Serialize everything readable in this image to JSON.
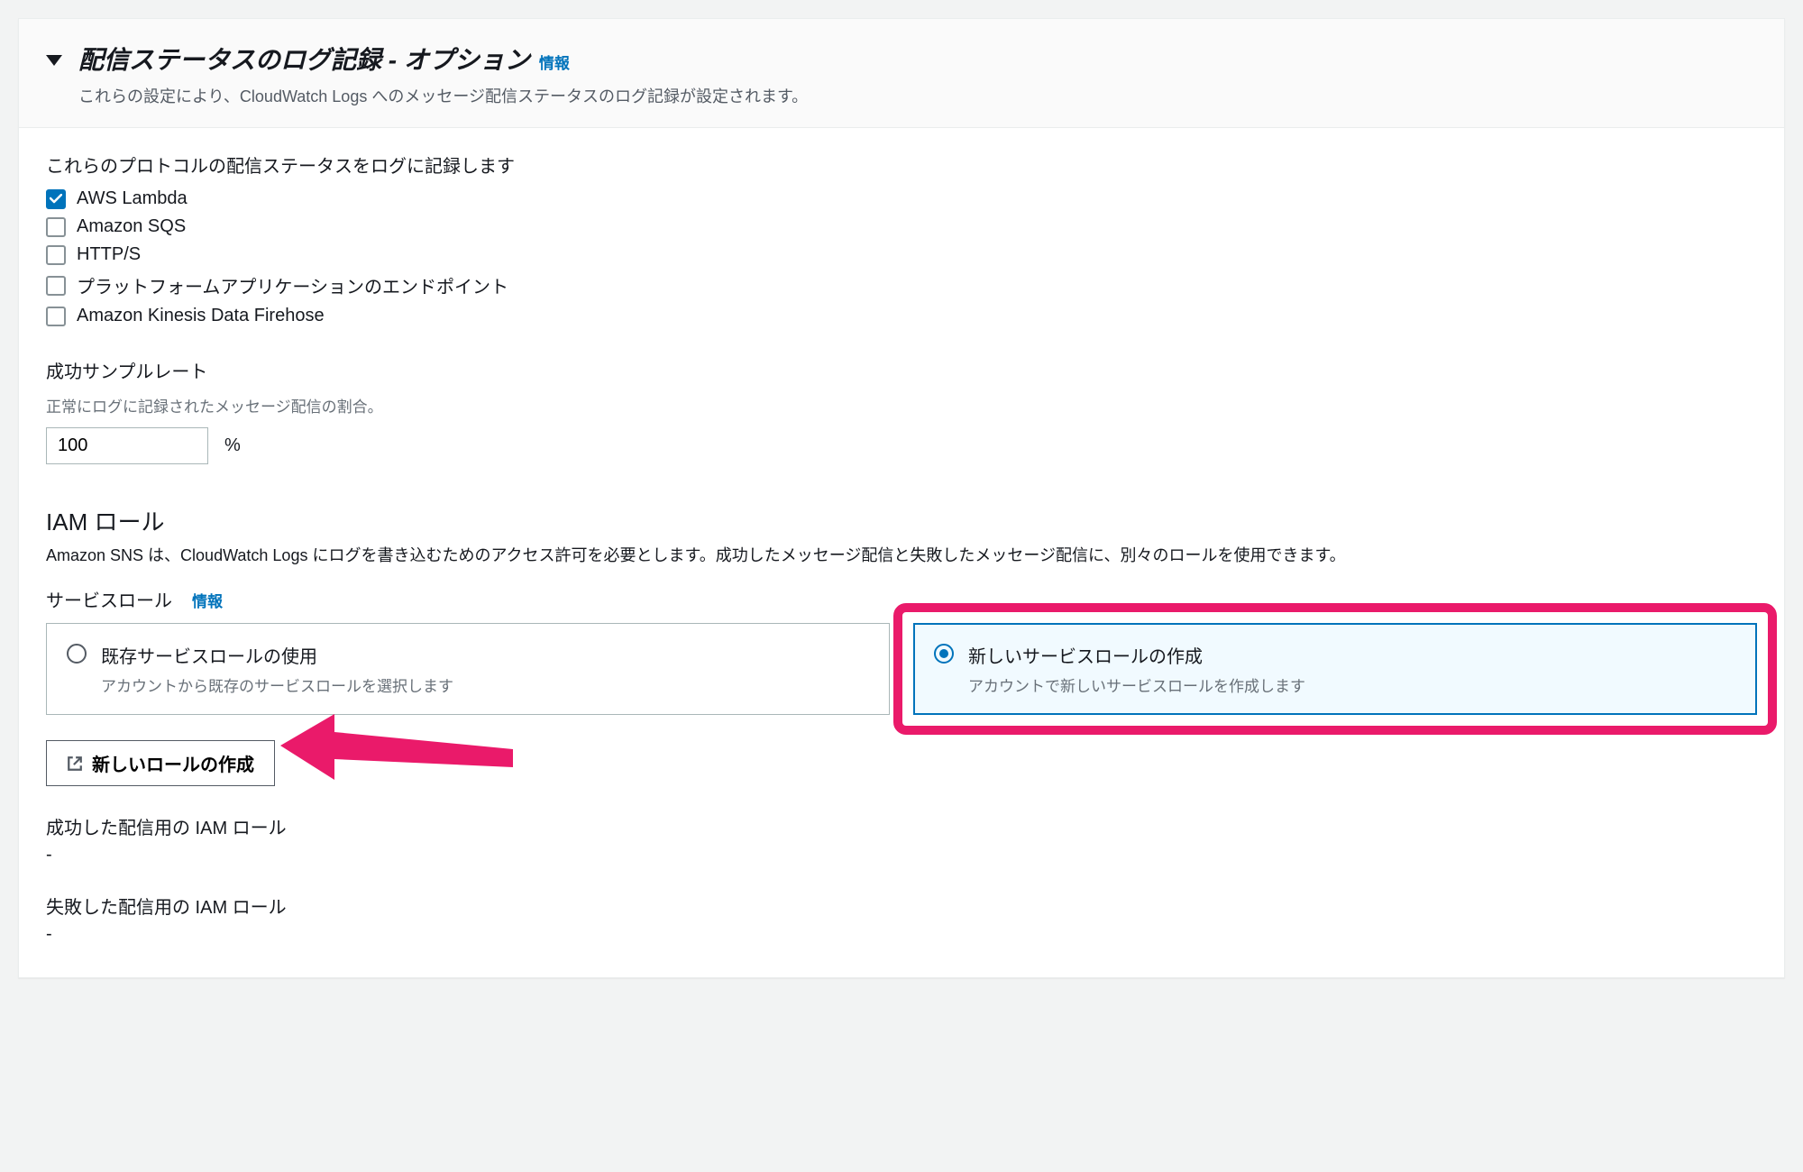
{
  "header": {
    "title": "配信ステータスのログ記録 - オプション",
    "info_label": "情報",
    "subtitle": "これらの設定により、CloudWatch Logs へのメッセージ配信ステータスのログ記録が設定されます。"
  },
  "protocols": {
    "label": "これらのプロトコルの配信ステータスをログに記録します",
    "items": [
      {
        "label": "AWS Lambda",
        "checked": true
      },
      {
        "label": "Amazon SQS",
        "checked": false
      },
      {
        "label": "HTTP/S",
        "checked": false
      },
      {
        "label": "プラットフォームアプリケーションのエンドポイント",
        "checked": false
      },
      {
        "label": "Amazon Kinesis Data Firehose",
        "checked": false
      }
    ]
  },
  "sample_rate": {
    "label": "成功サンプルレート",
    "help": "正常にログに記録されたメッセージ配信の割合。",
    "value": "100",
    "unit": "%"
  },
  "iam": {
    "heading": "IAM ロール",
    "desc": "Amazon SNS は、CloudWatch Logs にログを書き込むためのアクセス許可を必要とします。成功したメッセージ配信と失敗したメッセージ配信に、別々のロールを使用できます。",
    "service_role_label": "サービスロール",
    "service_role_info": "情報",
    "options": [
      {
        "title": "既存サービスロールの使用",
        "desc": "アカウントから既存のサービスロールを選択します",
        "selected": false
      },
      {
        "title": "新しいサービスロールの作成",
        "desc": "アカウントで新しいサービスロールを作成します",
        "selected": true
      }
    ],
    "create_button": "新しいロールの作成",
    "success_role_label": "成功した配信用の IAM ロール",
    "success_role_value": "-",
    "failure_role_label": "失敗した配信用の IAM ロール",
    "failure_role_value": "-"
  }
}
